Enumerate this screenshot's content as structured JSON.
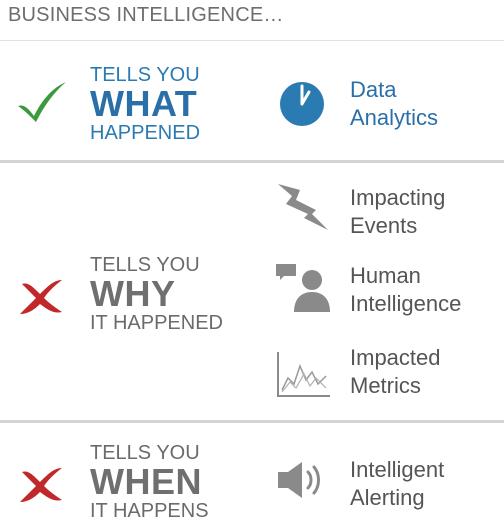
{
  "header": {
    "title": "BUSINESS INTELLIGENCE…"
  },
  "sections": [
    {
      "status": "yes",
      "status_icon": "check-icon",
      "line1": "TELLS YOU",
      "line2": "WHAT",
      "line3": "HAPPENED",
      "accent": "#2a7bb2",
      "capabilities": [
        {
          "icon": "pie-chart-icon",
          "line1": "Data",
          "line2": "Analytics"
        }
      ]
    },
    {
      "status": "no",
      "status_icon": "cross-icon",
      "line1": "TELLS YOU",
      "line2": "WHY",
      "line3": "IT HAPPENED",
      "accent": "#6b6b6b",
      "capabilities": [
        {
          "icon": "lightning-icon",
          "line1": "Impacting",
          "line2": "Events"
        },
        {
          "icon": "person-chat-icon",
          "line1": "Human",
          "line2": "Intelligence"
        },
        {
          "icon": "line-graph-icon",
          "line1": "Impacted",
          "line2": "Metrics"
        }
      ]
    },
    {
      "status": "no",
      "status_icon": "cross-icon",
      "line1": "TELLS YOU",
      "line2": "WHEN",
      "line3": "IT HAPPENS",
      "accent": "#6b6b6b",
      "capabilities": [
        {
          "icon": "speaker-icon",
          "line1": "Intelligent",
          "line2": "Alerting"
        }
      ]
    }
  ],
  "colors": {
    "check": "#3c9a3c",
    "cross": "#c0282a",
    "blue": "#2a7bb2",
    "gray": "#6b6b6b"
  }
}
